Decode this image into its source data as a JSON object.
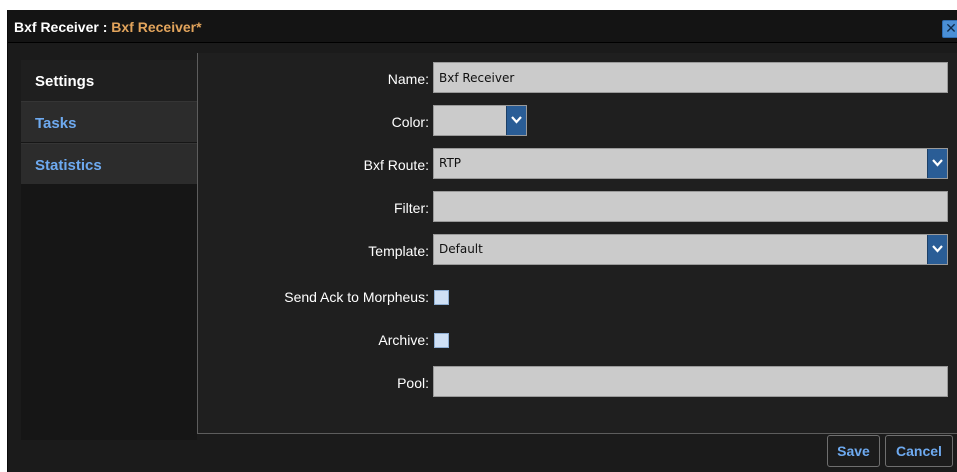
{
  "window": {
    "title_prefix": "Bxf Receiver : ",
    "title_name": "Bxf Receiver*",
    "close_glyph": "✕",
    "close_icon": "close-icon"
  },
  "sidebar": {
    "items": [
      {
        "label": "Settings",
        "active": true
      },
      {
        "label": "Tasks",
        "active": false
      },
      {
        "label": "Statistics",
        "active": false
      }
    ]
  },
  "form": {
    "name": {
      "label": "Name:",
      "value": "Bxf Receiver"
    },
    "color": {
      "label": "Color:",
      "value": ""
    },
    "bxf_route": {
      "label": "Bxf Route:",
      "value": "RTP"
    },
    "filter": {
      "label": "Filter:",
      "value": ""
    },
    "template": {
      "label": "Template:",
      "value": "Default"
    },
    "send_ack": {
      "label": "Send Ack to Morpheus:",
      "checked": false
    },
    "archive": {
      "label": "Archive:",
      "checked": false
    },
    "pool": {
      "label": "Pool:",
      "value": ""
    }
  },
  "footer": {
    "save_label": "Save",
    "cancel_label": "Cancel"
  },
  "colors": {
    "accent": "#6eaaf0",
    "title_highlight": "#e2a45c",
    "dropdown_button": "#2a5d96",
    "background": "#1b1b1b"
  }
}
